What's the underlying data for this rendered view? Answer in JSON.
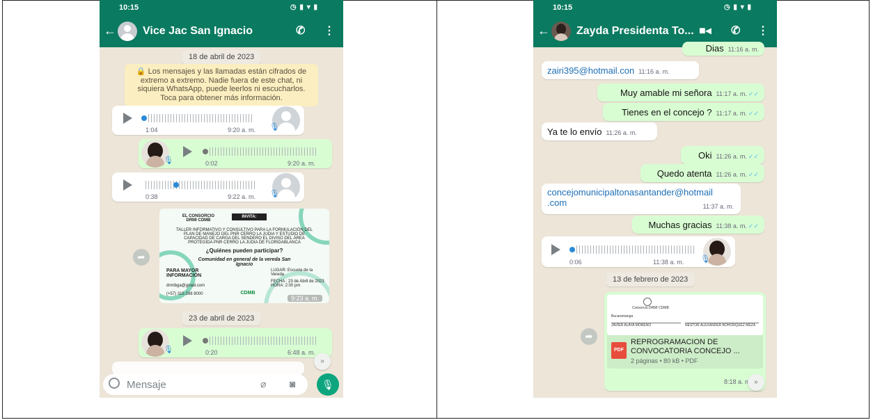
{
  "left": {
    "status_time": "10:15",
    "contact_name": "Vice Jac San Ignacio",
    "date1": "18 de abril de 2023",
    "encryption_notice": "🔒 Los mensajes y las llamadas están cifrados de extremo a extremo. Nadie fuera de este chat, ni siquiera WhatsApp, puede leerlos ni escucharlos. Toca para obtener más información.",
    "voice1": {
      "duration": "1:04",
      "time": "9:20 a. m."
    },
    "voice2": {
      "duration": "0:02",
      "time": "9:20 a. m."
    },
    "voice3": {
      "duration": "0:38",
      "time": "9:22 a. m."
    },
    "flyer": {
      "org": "EL CONSORCIO DRMI CDMB",
      "invita": "INVITA:",
      "body": "TALLER INFORMATIVO Y CONSULTIVO PARA LA FORMULACIÓN DEL PLAN DE MANEJO DEL PNR CERRO LA JUDIA Y ESTUDIO DE CAPACIDAD DE CARGA DEL SENDERO EL DIVISO DEL ÁREA PROTEGIDA PNR CERRO LA JUDIA DE FLORIDABLANCA",
      "question": "¿Quiénes pueden participar?",
      "answer": "Comunidad en general de la vereda San Ignacio",
      "more_info": "PARA MAYOR INFORMACIÓN",
      "email": "drmibga@gmail.com",
      "phone": "(+57) 315 288 8000",
      "place": "LUGAR: Escuela de la Vereda",
      "date": "FECHA : 23 de Abril de 2023 HORA: 2:00 pm",
      "logo": "CDMB",
      "time": "9:23 a. m."
    },
    "date2": "23 de abril de 2023",
    "voice4": {
      "duration": "0:20",
      "time": "6:48 a. m."
    },
    "composer_placeholder": "Mensaje"
  },
  "right": {
    "status_time": "10:15",
    "contact_name": "Zayda Presidenta To...",
    "messages": [
      {
        "text": "Dias",
        "time": "11:16 a. m.",
        "dir": "out"
      },
      {
        "text": "zairi395@hotmail.con",
        "time": "11:16 a. m.",
        "dir": "in"
      },
      {
        "text": "Muy amable mi señora",
        "time": "11:17 a. m.",
        "dir": "out"
      },
      {
        "text": "Tienes en el concejo ?",
        "time": "11:17 a. m.",
        "dir": "out"
      },
      {
        "text": "Ya te lo envío",
        "time": "11:26 a. m.",
        "dir": "in"
      },
      {
        "text": "Oki",
        "time": "11:26 a. m.",
        "dir": "out"
      },
      {
        "text": "Quedo atenta",
        "time": "11:26 a. m.",
        "dir": "out"
      },
      {
        "text_line1": "concejomunicipaltonasantander@hotmail",
        "text_line2": ".com",
        "time": "11:37 a. m.",
        "dir": "in"
      },
      {
        "text": "Muchas gracias",
        "time": "11:38 a. m.",
        "dir": "out"
      }
    ],
    "voice": {
      "duration": "0:06",
      "time": "11:38 a. m."
    },
    "date_chip": "13 de febrero de 2023",
    "pdf": {
      "preview_title": "Consorcio DRMI CDMB",
      "preview_sub": "Bucaramanga",
      "preview_cell1": "JAVIER ALAYA MORENO",
      "preview_cell2": "NESTOR ALEXANDER BOHORQUEZ MEZA",
      "name_line1": "REPROGRAMACION DE",
      "name_line2": "CONVOCATORIA CONCEJO ...",
      "meta": "2 páginas • 80 kB • PDF",
      "time": "8:18 a. m."
    }
  },
  "colors": {
    "header": "#0a7a60",
    "outgoing": "#d9fdd3",
    "incoming": "#ffffff",
    "chat_bg": "#ece5d8",
    "accent_blue": "#2a8ad8"
  }
}
